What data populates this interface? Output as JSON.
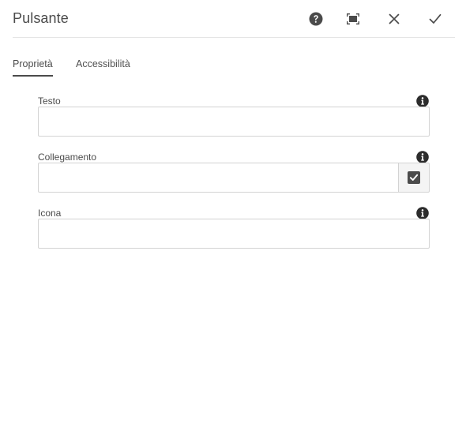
{
  "dialog": {
    "title": "Pulsante",
    "header_icons": [
      "help-icon",
      "fullscreen-icon",
      "close-icon",
      "checkmark-icon"
    ]
  },
  "tabs": [
    {
      "label": "Proprietà",
      "active": true
    },
    {
      "label": "Accessibilità",
      "active": false
    }
  ],
  "fields": {
    "text": {
      "label": "Testo",
      "value": ""
    },
    "link": {
      "label": "Collegamento",
      "value": ""
    },
    "icon": {
      "label": "Icona",
      "value": ""
    }
  },
  "colors": {
    "text": "#4b4b4b",
    "border": "#d3d3d3",
    "icon": "#2c2c2c"
  }
}
